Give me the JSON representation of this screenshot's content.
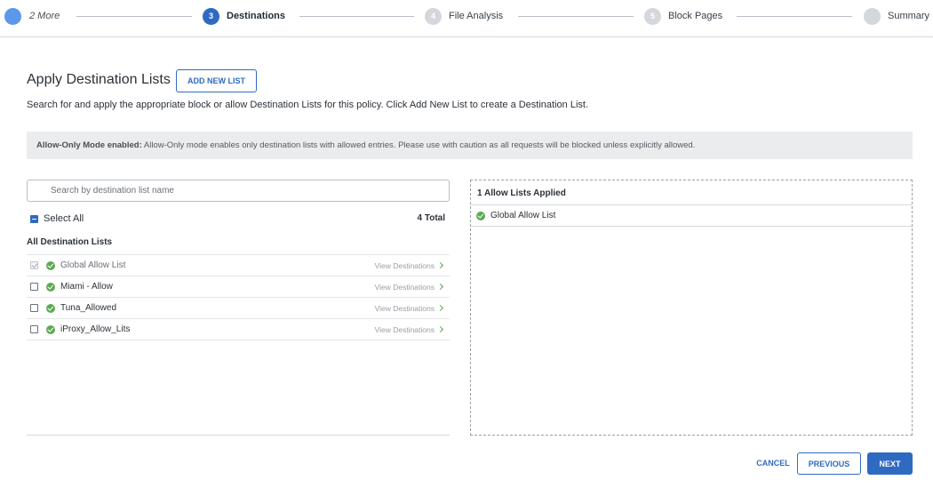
{
  "stepper": {
    "steps": [
      {
        "number": "",
        "label": "2 More",
        "state": "summary"
      },
      {
        "number": "3",
        "label": "Destinations",
        "state": "active"
      },
      {
        "number": "4",
        "label": "File Analysis",
        "state": "upcoming"
      },
      {
        "number": "5",
        "label": "Block Pages",
        "state": "upcoming"
      },
      {
        "number": "",
        "label": "Summary",
        "state": "upcoming"
      }
    ]
  },
  "header": {
    "title": "Apply Destination Lists",
    "add_button_label": "ADD NEW LIST",
    "description": "Search for and apply the appropriate block or allow Destination Lists for this policy. Click Add New List to create a Destination List."
  },
  "banner": {
    "bold_text": "Allow-Only Mode enabled:",
    "text": " Allow-Only mode enables only destination lists with allowed entries. Please use with caution as all requests will be blocked unless explicitly allowed."
  },
  "search": {
    "placeholder": "Search by destination list name",
    "value": ""
  },
  "list_controls": {
    "select_all_label": "Select All",
    "total_label": "4 Total",
    "section_title": "All Destination Lists"
  },
  "destination_lists": [
    {
      "name": "Global Allow List",
      "link": "View Destinations",
      "checked": true,
      "disabled": true
    },
    {
      "name": "Miami - Allow",
      "link": "View Destinations",
      "checked": false,
      "disabled": false
    },
    {
      "name": "Tuna_Allowed",
      "link": "View Destinations",
      "checked": false,
      "disabled": false
    },
    {
      "name": "iProxy_Allow_Lits",
      "link": "View Destinations",
      "checked": false,
      "disabled": false
    }
  ],
  "applied": {
    "header": "1 Allow Lists Applied",
    "items": [
      {
        "name": "Global Allow List"
      }
    ]
  },
  "footer": {
    "cancel_label": "CANCEL",
    "previous_label": "PREVIOUS",
    "next_label": "NEXT"
  },
  "colors": {
    "primary": "#2f6ac2",
    "stepper_summary": "#5c97ea",
    "success": "#5daa55",
    "banner_bg": "#ebeced"
  },
  "icons": {
    "status": "check-circle-icon",
    "link_arrow": "chevron-right-icon",
    "search": "search-icon"
  }
}
